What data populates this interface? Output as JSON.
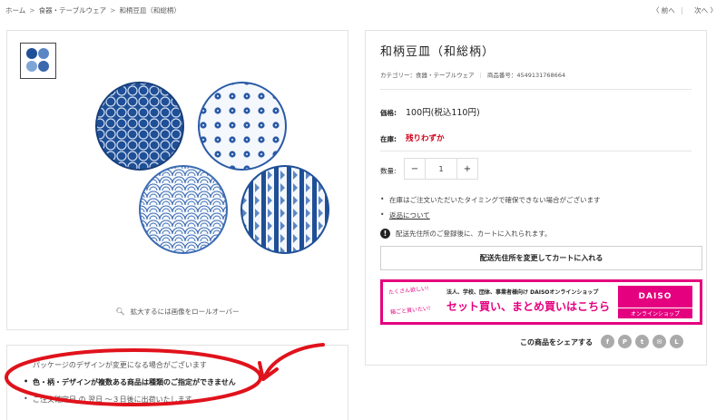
{
  "breadcrumb": {
    "home": "ホーム",
    "category": "食器・テーブルウェア",
    "current": "和柄豆皿（和総柄）",
    "separator": ">"
  },
  "pager": {
    "prev": "〈 前へ",
    "next": "次へ 〉",
    "divider": "|"
  },
  "gallery": {
    "zoom_hint": "拡大するには画像をロールオーバー"
  },
  "notes": {
    "items": [
      "パッケージのデザインが変更になる場合がございます",
      "色・柄・デザインが複数ある商品は種類のご指定ができません",
      "ご注文確定日 の 翌日 ～３日後に出荷いたします"
    ]
  },
  "product": {
    "title": "和柄豆皿（和総柄）",
    "category_label": "カテゴリー：食器・テーブルウェア",
    "sku_label": "商品番号：4549131768664",
    "price_label": "価格:",
    "price": "100円(税込110円)",
    "stock_label": "在庫:",
    "stock": "残りわずか",
    "qty_label": "数量:",
    "qty_minus": "−",
    "qty_value": "1",
    "qty_plus": "+",
    "info_1": "在庫はご注文いただいたタイミングで確保できない場合がございます",
    "info_2": "返品について",
    "warning": "配送先住所のご登録後に、カートに入れられます。",
    "cart_button": "配送先住所を変更してカートに入れる"
  },
  "banner": {
    "left_top": "たくさん欲しい!",
    "left_bottom": "箱ごと買いたい!",
    "sub": "法人、学校、団体、事業者様向け DAISOオンラインショップ",
    "main": "セット買い、まとめ買いはこちら",
    "logo": "DAISO",
    "shop": "オンラインショップ"
  },
  "share": {
    "label": "この商品をシェアする",
    "icons": [
      "facebook-icon",
      "pinterest-icon",
      "twitter-icon",
      "mail-icon",
      "line-icon"
    ]
  },
  "colors": {
    "accent": "#e5007f",
    "stock_red": "#d0021b",
    "plate_blue": "#1f4f96",
    "annotation_red": "#e0121b"
  }
}
